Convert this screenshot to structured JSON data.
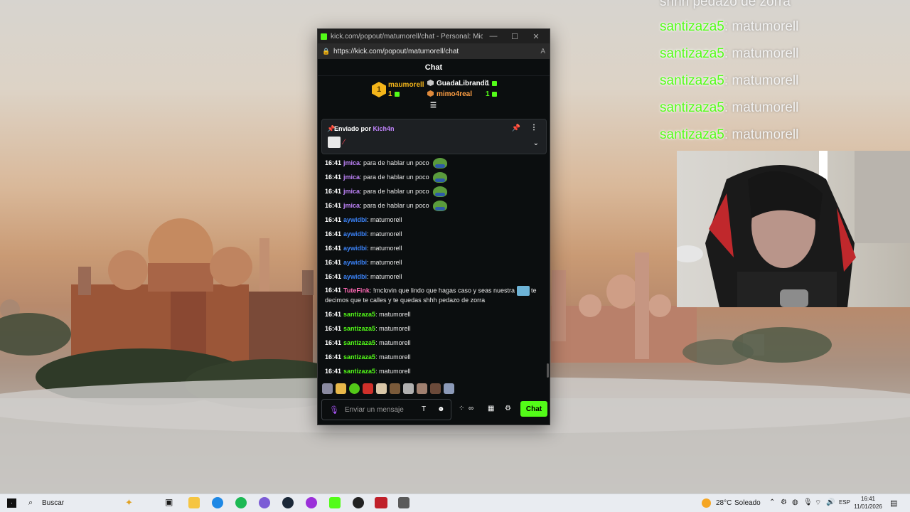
{
  "overlay": {
    "partial_line": "shhh pedazo de zorra",
    "lines": [
      {
        "user": "santizaza5",
        "text": ": matumorell"
      },
      {
        "user": "santizaza5",
        "text": ": matumorell"
      },
      {
        "user": "santizaza5",
        "text": ": matumorell"
      },
      {
        "user": "santizaza5",
        "text": ": matumorell"
      },
      {
        "user": "santizaza5",
        "text": ": matumorell"
      }
    ]
  },
  "browser": {
    "title": "kick.com/popout/matumorell/chat - Personal: Micr...",
    "url": "https://kick.com/popout/matumorell/chat",
    "window_buttons": {
      "minimize": "—",
      "maximize": "☐",
      "close": "✕"
    }
  },
  "chat": {
    "header": "Chat",
    "leaderboard": {
      "first": {
        "rank": "1",
        "name": "maumorell",
        "count": "1"
      },
      "second": {
        "name": "GuadaLibrandi",
        "count": "1"
      },
      "third": {
        "name": "mimo4real",
        "count": "1"
      }
    },
    "pinned": {
      "label": "Enviado por ",
      "sender": "Kich4n"
    },
    "messages": [
      {
        "time": "16:41",
        "user": "jmica",
        "user_color": "#c084fc",
        "text": ": para de hablar un poco",
        "emote": true
      },
      {
        "time": "16:41",
        "user": "jmica",
        "user_color": "#c084fc",
        "text": ": para de hablar un poco",
        "emote": true
      },
      {
        "time": "16:41",
        "user": "jmica",
        "user_color": "#c084fc",
        "text": ": para de hablar un poco",
        "emote": true
      },
      {
        "time": "16:41",
        "user": "jmica",
        "user_color": "#c084fc",
        "text": ": para de hablar un poco",
        "emote": true
      },
      {
        "time": "16:41",
        "user": "aywidbi",
        "user_color": "#3b82f6",
        "text": ": matumorell",
        "emote": false
      },
      {
        "time": "16:41",
        "user": "aywidbi",
        "user_color": "#3b82f6",
        "text": ": matumorell",
        "emote": false
      },
      {
        "time": "16:41",
        "user": "aywidbi",
        "user_color": "#3b82f6",
        "text": ": matumorell",
        "emote": false
      },
      {
        "time": "16:41",
        "user": "aywidbi",
        "user_color": "#3b82f6",
        "text": ": matumorell",
        "emote": false
      },
      {
        "time": "16:41",
        "user": "aywidbi",
        "user_color": "#3b82f6",
        "text": ": matumorell",
        "emote": false
      }
    ],
    "long_message": {
      "time": "16:41",
      "user": "TuteFink",
      "user_color": "#ff69b4",
      "text_before": ": !mclovin que lindo que hagas caso y seas nuestra",
      "text_after": " te decimos que te calles y te quedas shhh pedazo de zorra"
    },
    "messages_after": [
      {
        "time": "16:41",
        "user": "santizaza5",
        "user_color": "#53fc18",
        "text": ": matumorell"
      },
      {
        "time": "16:41",
        "user": "santizaza5",
        "user_color": "#53fc18",
        "text": ": matumorell"
      },
      {
        "time": "16:41",
        "user": "santizaza5",
        "user_color": "#53fc18",
        "text": ": matumorell"
      },
      {
        "time": "16:41",
        "user": "santizaza5",
        "user_color": "#53fc18",
        "text": ": matumorell"
      },
      {
        "time": "16:41",
        "user": "santizaza5",
        "user_color": "#53fc18",
        "text": ": matumorell"
      }
    ],
    "input_placeholder": "Enviar un mensaje",
    "send_label": "Chat",
    "colors": {
      "accent": "#53fc18",
      "background": "#0b0e0f"
    }
  },
  "taskbar": {
    "search_label": "Buscar",
    "temperature": "28°C",
    "weather": "Soleado",
    "language": "ESP",
    "time": "16:41",
    "date": "11/01/2026"
  }
}
